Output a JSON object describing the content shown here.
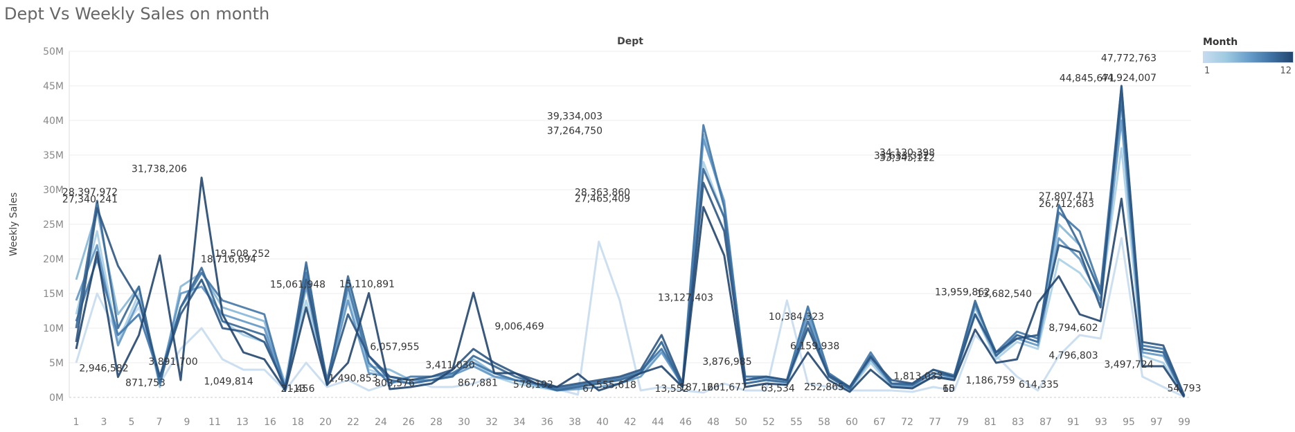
{
  "title": "Dept Vs Weekly Sales on month",
  "legend": {
    "title": "Month",
    "min_label": "1",
    "max_label": "12",
    "colors": [
      "#c6dbef",
      "#9ecae1",
      "#6a9fcb",
      "#3f73a5",
      "#22466f"
    ]
  },
  "chart_data": {
    "type": "line",
    "title": "Dept Vs Weekly Sales on month",
    "top_axis_label": "Dept",
    "xlabel": "",
    "ylabel": "Weekly Sales",
    "ylim": [
      0,
      50000000
    ],
    "y_ticks": [
      "0M",
      "5M",
      "10M",
      "15M",
      "20M",
      "25M",
      "30M",
      "35M",
      "40M",
      "45M",
      "50M"
    ],
    "x_ticks": [
      "1",
      "3",
      "5",
      "7",
      "9",
      "11",
      "13",
      "16",
      "18",
      "20",
      "22",
      "24",
      "26",
      "28",
      "30",
      "32",
      "34",
      "36",
      "38",
      "40",
      "42",
      "44",
      "46",
      "48",
      "50",
      "52",
      "55",
      "58",
      "60",
      "67",
      "72",
      "77",
      "79",
      "81",
      "83",
      "87",
      "91",
      "93",
      "95",
      "97",
      "99"
    ],
    "grid": true,
    "legend_position": "top-right",
    "color_scale": {
      "field": "Month",
      "min": 1,
      "max": 12
    },
    "series": [
      {
        "month": 1,
        "values": [
          5000000,
          15000000,
          9000000,
          13000000,
          2000000,
          7000000,
          10000000,
          5500000,
          4000000,
          4000000,
          1000000,
          5000000,
          1500000,
          2500000,
          1000000,
          2000000,
          2500000,
          1500000,
          1500000,
          2000000,
          3000000,
          2500000,
          1500000,
          1200000,
          400000,
          22500000,
          14000000,
          1000000,
          1500000,
          1000000,
          700000,
          2000000,
          1000000,
          1000000,
          14000000,
          2000000,
          1500000,
          1000000,
          1000000,
          1000000,
          800000,
          1500000,
          1000000,
          9000000,
          6000000,
          3000000,
          1000000,
          6000000,
          9000000,
          8500000,
          23000000,
          3000000,
          1500000,
          100000
        ]
      },
      {
        "month": 3,
        "values": [
          12000000,
          24000000,
          8000000,
          15000000,
          3000000,
          13000000,
          17000000,
          11000000,
          9000000,
          8000000,
          1800000,
          14000000,
          2500000,
          15000000,
          4000000,
          3000000,
          2000000,
          2500000,
          3500000,
          5000000,
          3000000,
          2000000,
          1500000,
          1000000,
          1500000,
          2000000,
          2500000,
          3500000,
          7000000,
          1500000,
          34000000,
          26000000,
          2000000,
          2500000,
          2000000,
          10000000,
          3000000,
          1000000,
          5000000,
          1500000,
          1500000,
          3000000,
          2500000,
          12000000,
          5500000,
          8000000,
          7000000,
          20000000,
          18000000,
          14000000,
          36000000,
          6000000,
          5000000,
          200000
        ]
      },
      {
        "month": 5,
        "values": [
          17000000,
          27000000,
          12000000,
          16000000,
          1500000,
          16000000,
          18000000,
          13000000,
          12000000,
          11000000,
          2000000,
          19000000,
          2000000,
          17000000,
          4500000,
          4000000,
          2500000,
          2500000,
          3500000,
          5500000,
          3500000,
          2500000,
          2000000,
          1200000,
          1500000,
          2000000,
          2500000,
          3500000,
          8000000,
          2000000,
          38000000,
          27500000,
          3000000,
          3000000,
          2500000,
          13000000,
          3500000,
          1200000,
          6000000,
          2000000,
          1800000,
          3500000,
          3000000,
          13000000,
          6500000,
          9000000,
          8000000,
          25000000,
          22000000,
          15000000,
          42000000,
          7000000,
          6500000,
          200000
        ]
      },
      {
        "month": 7,
        "values": [
          14000000,
          22000000,
          7500000,
          14000000,
          2500000,
          15000000,
          16000000,
          12000000,
          11000000,
          10000000,
          1500000,
          16000000,
          2000000,
          14000000,
          3500000,
          3000000,
          2500000,
          2500000,
          3200000,
          4500000,
          3000000,
          2500000,
          1800000,
          1000000,
          1200000,
          1500000,
          2000000,
          3000000,
          6500000,
          1800000,
          37264750,
          28363860,
          2500000,
          2800000,
          2500000,
          12000000,
          3000000,
          1200000,
          5500000,
          1800000,
          1500000,
          3000000,
          2800000,
          12000000,
          6000000,
          8500000,
          7500000,
          23000000,
          20000000,
          14000000,
          40000000,
          6500000,
          6000000,
          200000
        ]
      },
      {
        "month": 9,
        "values": [
          11000000,
          20000000,
          9000000,
          12000000,
          3000000,
          13000000,
          18000000,
          14000000,
          13000000,
          12000000,
          1200000,
          18000000,
          2500000,
          16000000,
          5000000,
          2000000,
          3000000,
          3000000,
          3500000,
          5000000,
          3500000,
          2500000,
          2000000,
          1200000,
          1800000,
          2200000,
          2800000,
          3800000,
          7000000,
          2000000,
          39334003,
          27465409,
          3000000,
          3000000,
          2500000,
          13127403,
          3500000,
          1500000,
          6500000,
          2000000,
          2000000,
          4000000,
          3200000,
          13500000,
          6500000,
          9500000,
          8500000,
          26712683,
          24000000,
          15500000,
          44845671,
          7500000,
          7000000,
          200000
        ]
      },
      {
        "month": 10,
        "values": [
          10000000,
          28397972,
          10000000,
          16000000,
          2000000,
          13000000,
          18716694,
          11000000,
          10000000,
          9000000,
          1000000,
          19508252,
          1800000,
          17500000,
          6000000,
          2500000,
          2000000,
          2500000,
          3000000,
          6000000,
          4500000,
          3000000,
          2000000,
          1000000,
          1500000,
          2000000,
          2500000,
          3500000,
          8000000,
          1500000,
          33000000,
          26000000,
          2000000,
          2500000,
          2200000,
          11000000,
          3000000,
          1200000,
          6000000,
          2000000,
          1800000,
          3500000,
          3000000,
          13959862,
          6000000,
          9000000,
          8000000,
          27807471,
          22000000,
          15000000,
          43000000,
          7000000,
          6500000,
          200000
        ]
      },
      {
        "month": 11,
        "values": [
          8000000,
          27340241,
          19000000,
          14000000,
          3000000,
          12000000,
          17000000,
          10000000,
          9500000,
          8000000,
          1500000,
          17000000,
          2000000,
          12000000,
          6000000,
          3000000,
          2500000,
          3000000,
          4000000,
          7000000,
          5000000,
          3500000,
          2500000,
          1500000,
          2000000,
          2500000,
          3000000,
          4000000,
          9006469,
          2000000,
          31000000,
          24000000,
          2500000,
          3000000,
          2500000,
          10000000,
          3200000,
          1500000,
          5800000,
          2500000,
          2000000,
          4000000,
          3000000,
          12000000,
          6500000,
          8500000,
          9000000,
          22000000,
          21000000,
          13000000,
          45000000,
          8000000,
          7500000,
          300000
        ]
      },
      {
        "month": 12,
        "values": [
          7000000,
          21000000,
          2946582,
          9000000,
          20500000,
          2500000,
          31738206,
          12000000,
          6500000,
          5500000,
          1049814,
          13000000,
          1800000,
          5000000,
          15061948,
          1200000,
          1500000,
          2000000,
          4000000,
          15110891,
          3500000,
          3500000,
          2000000,
          1500000,
          3411030,
          1000000,
          2000000,
          3500000,
          4500000,
          1500000,
          27500000,
          20500000,
          1500000,
          2000000,
          1800000,
          6500000,
          2500000,
          800000,
          4000000,
          1500000,
          1300000,
          3000000,
          2500000,
          9800000,
          5000000,
          5500000,
          13682540,
          17500000,
          12000000,
          11000000,
          28700000,
          4500000,
          4500000,
          54793
        ]
      }
    ],
    "data_labels": [
      {
        "x": "2",
        "value": "28,397,972"
      },
      {
        "x": "2",
        "value": "27,340,241"
      },
      {
        "x": "3",
        "value": "2,946,582"
      },
      {
        "x": "6",
        "value": "871,753"
      },
      {
        "x": "7",
        "value": "31,738,206"
      },
      {
        "x": "8",
        "value": "3,891,700"
      },
      {
        "x": "12",
        "value": "18,716,694"
      },
      {
        "x": "12",
        "value": "1,049,814"
      },
      {
        "x": "13",
        "value": "19,508,252"
      },
      {
        "x": "18",
        "value": "15,061,948"
      },
      {
        "x": "18",
        "value": "21,456"
      },
      {
        "x": "18",
        "value": "-13"
      },
      {
        "x": "22",
        "value": "1,490,853"
      },
      {
        "x": "23",
        "value": "15,110,891"
      },
      {
        "x": "25",
        "value": "6,057,955"
      },
      {
        "x": "25",
        "value": "803,576"
      },
      {
        "x": "29",
        "value": "3,411,030"
      },
      {
        "x": "31",
        "value": "867,881"
      },
      {
        "x": "34",
        "value": "9,006,469"
      },
      {
        "x": "35",
        "value": "578,192"
      },
      {
        "x": "38",
        "value": "39,334,003"
      },
      {
        "x": "38",
        "value": "37,264,750"
      },
      {
        "x": "39",
        "value": "67"
      },
      {
        "x": "40",
        "value": "28,363,860"
      },
      {
        "x": "40",
        "value": "27,465,409"
      },
      {
        "x": "41",
        "value": "555,618"
      },
      {
        "x": "45",
        "value": "13,552"
      },
      {
        "x": "46",
        "value": "13,127,403"
      },
      {
        "x": "47",
        "value": "187,166"
      },
      {
        "x": "49",
        "value": "3,876,985"
      },
      {
        "x": "49",
        "value": "201,677"
      },
      {
        "x": "53",
        "value": "63,534"
      },
      {
        "x": "55",
        "value": "10,384,323"
      },
      {
        "x": "57",
        "value": "6,159,938"
      },
      {
        "x": "58",
        "value": "252,865"
      },
      {
        "x": "71",
        "value": "33,633,332"
      },
      {
        "x": "72",
        "value": "34,120,398"
      },
      {
        "x": "72",
        "value": "33,345,112"
      },
      {
        "x": "74",
        "value": "1,813,033"
      },
      {
        "x": "78",
        "value": "10"
      },
      {
        "x": "78",
        "value": "65"
      },
      {
        "x": "79",
        "value": "13,959,862"
      },
      {
        "x": "81",
        "value": "1,186,759"
      },
      {
        "x": "82",
        "value": "13,682,540"
      },
      {
        "x": "86",
        "value": "614,335"
      },
      {
        "x": "90",
        "value": "27,807,471"
      },
      {
        "x": "90",
        "value": "26,712,683"
      },
      {
        "x": "91",
        "value": "8,794,602"
      },
      {
        "x": "91",
        "value": "4,796,803"
      },
      {
        "x": "92",
        "value": "44,845,671"
      },
      {
        "x": "95",
        "value": "47,772,763"
      },
      {
        "x": "95",
        "value": "44,924,007"
      },
      {
        "x": "95",
        "value": "3,497,724"
      },
      {
        "x": "99",
        "value": "54,793"
      }
    ]
  }
}
